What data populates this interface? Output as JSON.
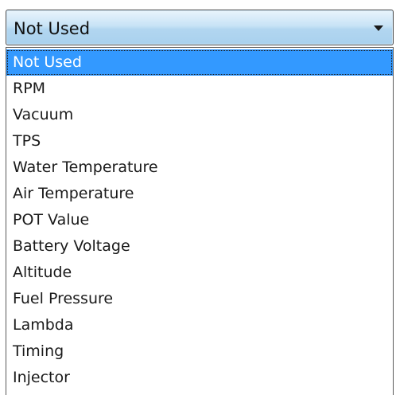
{
  "combo": {
    "value": "Not Used",
    "arrow_icon": "chevron-down-icon"
  },
  "dropdown": {
    "selected_index": 0,
    "colors": {
      "selected_bg": "#3399ff",
      "selected_text": "#ffffff",
      "combo_bg": "#b9dcf3"
    },
    "options": [
      "Not Used",
      "RPM",
      "Vacuum",
      "TPS",
      "Water Temperature",
      "Air Temperature",
      "POT Value",
      "Battery Voltage",
      "Altitude",
      "Fuel Pressure",
      "Lambda",
      "Timing",
      "Injector"
    ]
  }
}
